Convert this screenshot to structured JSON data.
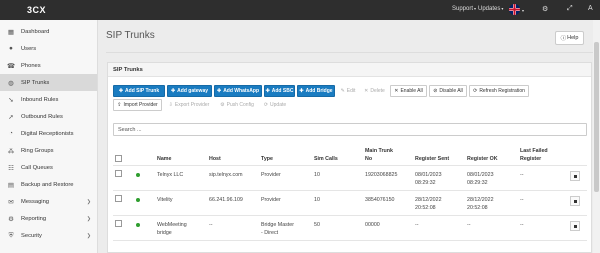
{
  "topbar": {
    "logo": "3CX",
    "support": "Support",
    "updates": "Updates",
    "user_initial": "A"
  },
  "sidebar": {
    "items": [
      {
        "label": "Dashboard",
        "icon": "dashboard-icon"
      },
      {
        "label": "Users",
        "icon": "user-icon"
      },
      {
        "label": "Phones",
        "icon": "phone-icon"
      },
      {
        "label": "SIP Trunks",
        "icon": "globe-icon",
        "active": true
      },
      {
        "label": "Inbound Rules",
        "icon": "inbound-icon"
      },
      {
        "label": "Outbound Rules",
        "icon": "outbound-icon"
      },
      {
        "label": "Digital Receptionists",
        "icon": "receptionist-icon"
      },
      {
        "label": "Ring Groups",
        "icon": "ring-group-icon"
      },
      {
        "label": "Call Queues",
        "icon": "queue-icon"
      },
      {
        "label": "Backup and Restore",
        "icon": "backup-icon"
      },
      {
        "label": "Messaging",
        "icon": "chat-icon",
        "expandable": true
      },
      {
        "label": "Reporting",
        "icon": "reporting-icon",
        "expandable": true
      },
      {
        "label": "Security",
        "icon": "shield-icon",
        "expandable": true
      }
    ]
  },
  "main": {
    "title": "SIP Trunks",
    "help": "Help",
    "panel_title": "SIP Trunks",
    "toolbar": {
      "add_sip_trunk": "Add SIP Trunk",
      "add_gateway": "Add gateway",
      "add_whatsapp": "Add WhatsApp",
      "add_sbc": "Add SBC",
      "add_bridge": "Add Bridge",
      "edit": "Edit",
      "delete": "Delete",
      "enable_all": "Enable All",
      "disable_all": "Disable All",
      "refresh_registration": "Refresh Registration",
      "import_provider": "Import Provider",
      "export_provider": "Export Provider",
      "push_config": "Push Config",
      "update": "Update"
    },
    "search": {
      "placeholder": "Search ..."
    },
    "table": {
      "headers": {
        "name": "Name",
        "host": "Host",
        "type": "Type",
        "sim_calls": "Sim Calls",
        "main_trunk_no": [
          "Main Trunk",
          "No"
        ],
        "register_sent": "Register Sent",
        "register_ok": "Register OK",
        "last_failed_register": [
          "Last Failed",
          "Register"
        ]
      },
      "rows": [
        {
          "status": "online",
          "name": [
            "Telnyx LLC"
          ],
          "host": "sip.telnyx.com",
          "type": [
            "Provider"
          ],
          "sim_calls": "10",
          "main_trunk_no": "19203068825",
          "register_sent": [
            "08/01/2023",
            "08:29:32"
          ],
          "register_ok": [
            "08/01/2023",
            "08:29:32"
          ],
          "last_failed": "--"
        },
        {
          "status": "online",
          "name": [
            "Vitelity"
          ],
          "host": "66.241.96.109",
          "type": [
            "Provider"
          ],
          "sim_calls": "10",
          "main_trunk_no": "3854076150",
          "register_sent": [
            "28/12/2022",
            "20:52:08"
          ],
          "register_ok": [
            "28/12/2022",
            "20:52:08"
          ],
          "last_failed": "--"
        },
        {
          "status": "online",
          "name": [
            "WebMeeting",
            "bridge"
          ],
          "host": "--",
          "type": [
            "Bridge Master",
            "- Direct"
          ],
          "sim_calls": "50",
          "main_trunk_no": "00000",
          "register_sent": [
            "--"
          ],
          "register_ok": [
            "--"
          ],
          "last_failed": "--"
        }
      ]
    }
  },
  "colors": {
    "topbar": "#2e2e2e",
    "primary_button": "#1a7cc1",
    "status_online": "#2f9e2f",
    "active_sidebar": "#d9d9d9"
  }
}
